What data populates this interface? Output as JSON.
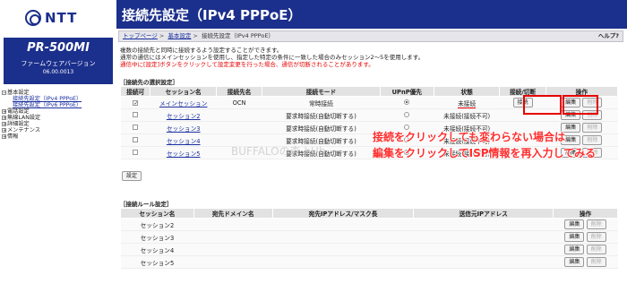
{
  "logo": {
    "text": "NTT"
  },
  "product": {
    "model": "PR-500MI",
    "fw_label": "ファームウェアバージョン",
    "fw_version": "06.00.0013"
  },
  "tree": [
    {
      "kind": "top",
      "label": "基本設定",
      "open": true
    },
    {
      "kind": "sub",
      "label": "接続先設定（IPv4 PPPoE）"
    },
    {
      "kind": "sub",
      "label": "接続先設定（IPv6 PPPoE）"
    },
    {
      "kind": "top",
      "label": "電話設定"
    },
    {
      "kind": "top",
      "label": "無線LAN設定"
    },
    {
      "kind": "top",
      "label": "詳細設定"
    },
    {
      "kind": "top",
      "label": "メンテナンス"
    },
    {
      "kind": "top",
      "label": "情報"
    }
  ],
  "header": {
    "title": "接続先設定（IPv4 PPPoE）"
  },
  "breadcrumb": {
    "items": [
      "トップページ",
      "基本設定",
      "接続先設定（IPv4 PPPoE）"
    ],
    "help": "ヘルプ?"
  },
  "description": {
    "line1": "複数の接続先と同時に接続するよう設定することができます。",
    "line2": "通常の通信にはメインセッションを使用し、指定した特定の条件に一致した場合のみセッション2～5を使用します。",
    "line3": "通信中に[設定]ボタンをクリックして設定変更を行った場合、通信が切断されることがあります。"
  },
  "select_section": {
    "title": "［接続先の選択設定］",
    "headers": [
      "接続可",
      "セッション名",
      "接続先名",
      "接続モード",
      "UPnP優先",
      "状態",
      "接続/切断",
      "操作"
    ],
    "rows": [
      {
        "enabled": true,
        "session": "メインセッション",
        "dest": "OCN",
        "mode": "常時接続",
        "upnp": true,
        "status": "未接続",
        "connect": "接続",
        "edit": "編集",
        "del": "削除"
      },
      {
        "enabled": false,
        "session": "セッション2",
        "dest": "",
        "mode": "要求時接続(自動切断する)",
        "upnp": false,
        "status": "未接続(接続不可)",
        "connect": "",
        "edit": "編集",
        "del": "削除"
      },
      {
        "enabled": false,
        "session": "セッション3",
        "dest": "",
        "mode": "要求時接続(自動切断する)",
        "upnp": false,
        "status": "未接続(接続不可)",
        "connect": "",
        "edit": "編集",
        "del": "削除"
      },
      {
        "enabled": false,
        "session": "セッション4",
        "dest": "",
        "mode": "要求時接続(自動切断する)",
        "upnp": false,
        "status": "未接続(接続不可)",
        "connect": "",
        "edit": "編集",
        "del": "削除"
      },
      {
        "enabled": false,
        "session": "セッション5",
        "dest": "",
        "mode": "要求時接続(自動切断する)",
        "upnp": false,
        "status": "未接続(接続不可)",
        "connect": "",
        "edit": "編集",
        "del": "削除"
      }
    ],
    "set_button": "設定"
  },
  "rule_section": {
    "title": "［接続ルール設定］",
    "headers": [
      "セッション名",
      "宛先ドメイン名",
      "宛先IPアドレス/マスク長",
      "送信元IPアドレス",
      "操作"
    ],
    "rows": [
      {
        "session": "セッション2",
        "edit": "編集",
        "del": "削除"
      },
      {
        "session": "セッション3",
        "edit": "編集",
        "del": "削除"
      },
      {
        "session": "セッション4",
        "edit": "編集",
        "del": "削除"
      },
      {
        "session": "セッション5",
        "edit": "編集",
        "del": "削除"
      }
    ]
  },
  "annotations": {
    "line1": "接続をクリックしても変わらない場合は",
    "line2": "編集をクリックしてISP情報を再入力してみる",
    "color": "#ff2e2e"
  },
  "watermark": "BUFFALOの森 hUb"
}
